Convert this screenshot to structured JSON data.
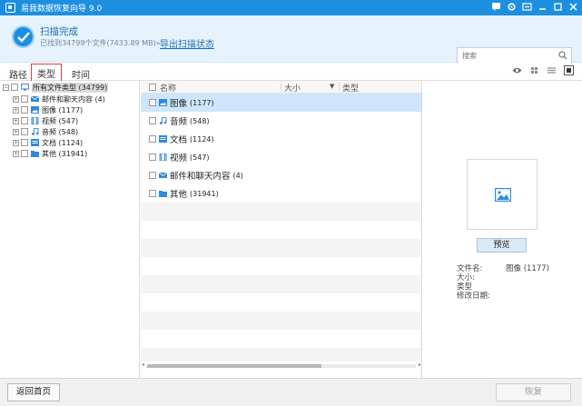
{
  "window": {
    "title": "易我数据恢复向导 9.0"
  },
  "status": {
    "title": "扫描完成",
    "subtitle": "已找到34799个文件(7433.89 MB)»",
    "export_link": "导出扫描状态"
  },
  "search": {
    "placeholder": "搜索"
  },
  "tabs": [
    {
      "label": "路径"
    },
    {
      "label": "类型",
      "selected": true
    },
    {
      "label": "时间"
    }
  ],
  "tree": {
    "root": {
      "label": "所有文件类型",
      "count": "(34799)"
    },
    "items": [
      {
        "label": "邮件和聊天内容",
        "count": "(4)",
        "icon": "mail-icon"
      },
      {
        "label": "图像",
        "count": "(1177)",
        "icon": "image-icon"
      },
      {
        "label": "视频",
        "count": "(547)",
        "icon": "video-icon"
      },
      {
        "label": "音频",
        "count": "(548)",
        "icon": "music-icon"
      },
      {
        "label": "文档",
        "count": "(1124)",
        "icon": "document-icon"
      },
      {
        "label": "其他",
        "count": "(31941)",
        "icon": "folder-icon"
      }
    ]
  },
  "list": {
    "columns": {
      "name": "名称",
      "size": "大小",
      "type": "类型"
    },
    "rows": [
      {
        "name": "图像",
        "count": "(1177)",
        "icon": "image-icon",
        "selected": true
      },
      {
        "name": "音频",
        "count": "(548)",
        "icon": "music-icon"
      },
      {
        "name": "文档",
        "count": "(1124)",
        "icon": "document-icon"
      },
      {
        "name": "视频",
        "count": "(547)",
        "icon": "video-icon"
      },
      {
        "name": "邮件和聊天内容",
        "count": "(4)",
        "icon": "mail-icon"
      },
      {
        "name": "其他",
        "count": "(31941)",
        "icon": "folder-icon"
      }
    ]
  },
  "preview": {
    "button": "预览",
    "labels": {
      "filename": "文件名:",
      "size": "大小:",
      "type": "类型",
      "modified": "修改日期:"
    },
    "values": {
      "filename": "图像 (1177)"
    }
  },
  "footer": {
    "back": "返回首页",
    "recover": "恢复"
  },
  "colors": {
    "titlebar": "#1d8fe0",
    "banner": "#e6f2fc",
    "selected_row": "#cde6fb",
    "tab_highlight": "#e23a3a"
  }
}
